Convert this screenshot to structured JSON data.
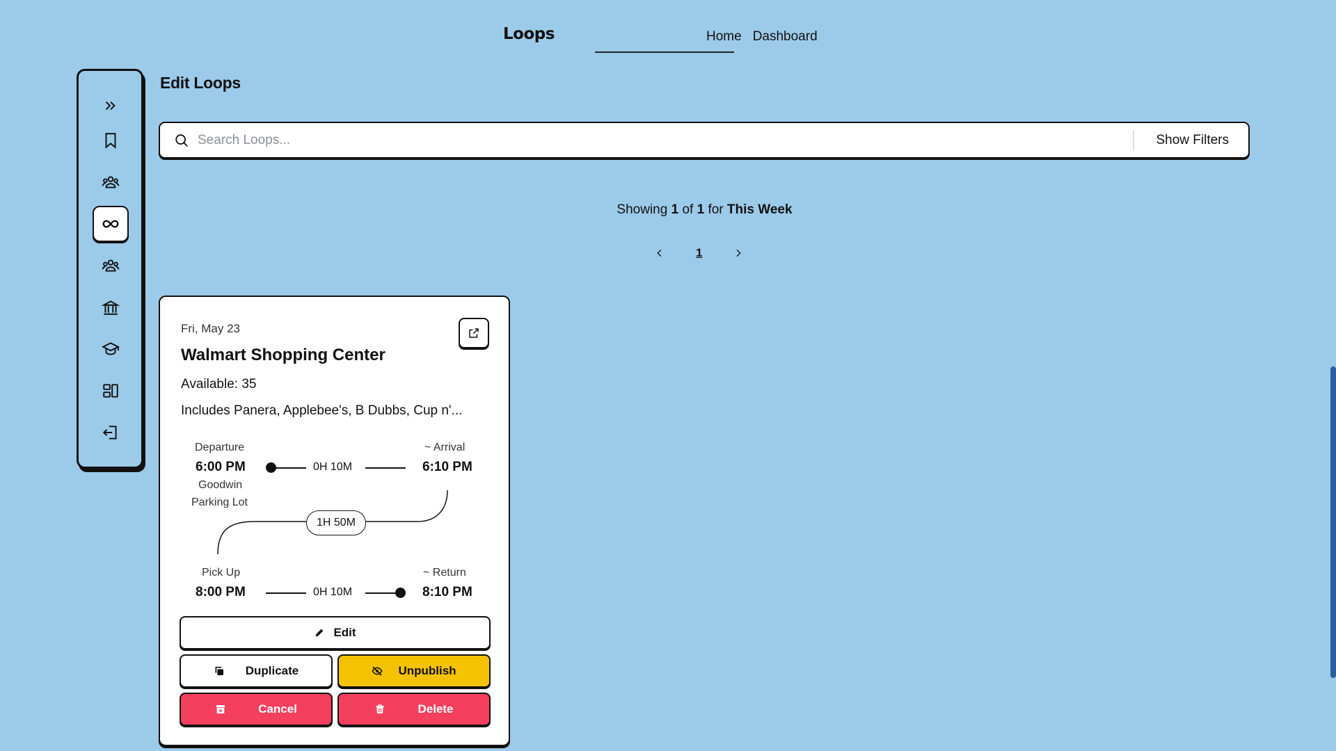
{
  "header": {
    "logo": "Loops",
    "nav": [
      "Home",
      "Dashboard"
    ]
  },
  "sidebar": {
    "items": [
      {
        "icon": "chevrons-right-icon"
      },
      {
        "icon": "bookmark-icon"
      },
      {
        "icon": "users-icon"
      },
      {
        "icon": "infinity-icon",
        "active": true
      },
      {
        "icon": "users-group-icon"
      },
      {
        "icon": "bank-icon"
      },
      {
        "icon": "graduation-cap-icon"
      },
      {
        "icon": "dashboard-icon"
      },
      {
        "icon": "logout-icon"
      }
    ]
  },
  "main": {
    "title": "Edit Loops",
    "search": {
      "placeholder": "Search Loops...",
      "value": "",
      "filters_label": "Show Filters"
    },
    "showing": {
      "prefix": "Showing",
      "current": "1",
      "of": "of",
      "total": "1",
      "for": "for",
      "period": "This Week"
    },
    "pagination": {
      "page": "1"
    }
  },
  "card": {
    "date": "Fri, May 23",
    "title": "Walmart Shopping Center",
    "available": "Available: 35",
    "includes": "Includes Panera, Applebee's, B Dubbs, Cup n'...",
    "departure_label": "Departure",
    "departure_time": "6:00 PM",
    "outbound_duration": "0H 10M",
    "arrival_label": "~ Arrival",
    "arrival_time": "6:10 PM",
    "location_line1": "Goodwin",
    "location_line2": "Parking Lot",
    "stay_duration": "1H 50M",
    "pickup_label": "Pick Up",
    "pickup_time": "8:00 PM",
    "return_duration": "0H 10M",
    "return_label": "~ Return",
    "return_time": "8:10 PM",
    "buttons": {
      "edit": "Edit",
      "duplicate": "Duplicate",
      "unpublish": "Unpublish",
      "cancel": "Cancel",
      "delete": "Delete"
    }
  },
  "colors": {
    "background": "#9ccbea",
    "unpublish": "#f4c200",
    "danger": "#f43f5e",
    "scrollbar": "#2a5f9e"
  }
}
